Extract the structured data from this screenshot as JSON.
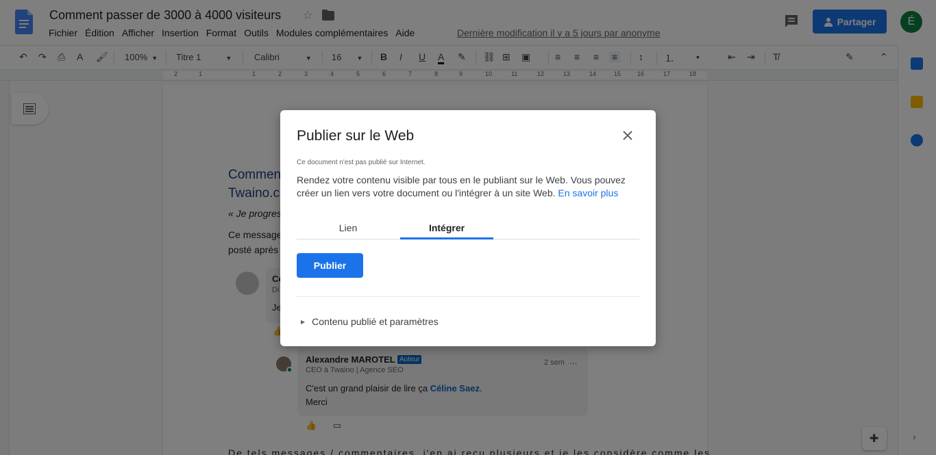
{
  "header": {
    "title": "Comment passer de 3000 à 4000 visiteurs",
    "menu": [
      "Fichier",
      "Édition",
      "Afficher",
      "Insertion",
      "Format",
      "Outils",
      "Modules complémentaires",
      "Aide"
    ],
    "last_edit": "Dernière modification il y a 5 jours par anonyme",
    "share_label": "Partager",
    "avatar_letter": "É"
  },
  "toolbar": {
    "zoom": "100%",
    "style": "Titre 1",
    "font": "Calibri",
    "size": "16"
  },
  "ruler": {
    "numbers": [
      "2",
      "1",
      "1",
      "2",
      "3",
      "4",
      "5",
      "6",
      "7",
      "8",
      "9",
      "10",
      "11",
      "12",
      "13",
      "14",
      "15",
      "16",
      "17",
      "18"
    ]
  },
  "document": {
    "heading_line1": "Comment",
    "heading_line2": "Twaino.c",
    "quote_start": "« Je progres",
    "para_line1": "Ce message",
    "para_line2": "posté après",
    "bottom_line": "De tels messages / commentaires, j'en ai reçu plusieurs et je les considère comme les"
  },
  "comment": {
    "name": "Alexandre MAROTEL",
    "badge": "Auteur",
    "time": "2 sem",
    "subtitle": "CEO à Twaino | Agence SEO",
    "text_before": "C'est un grand plaisir de lire ça ",
    "mention": "Céline Saez",
    "text_line2": "Merci",
    "first_card_initial": "Ce",
    "first_card_sub": "Di",
    "first_card_text": "Je"
  },
  "dialog": {
    "title": "Publier sur le Web",
    "status": "Ce document n'est pas publié sur Internet.",
    "description": "Rendez votre contenu visible par tous en le publiant sur le Web. Vous pouvez créer un lien vers votre document ou l'intégrer à un site Web. ",
    "learn_more": "En savoir plus",
    "tabs": [
      "Lien",
      "Intégrer"
    ],
    "active_tab": "Intégrer",
    "publish_label": "Publier",
    "settings_label": "Contenu publié et paramètres"
  },
  "colors": {
    "accent": "#1a73e8",
    "heading": "#1a3f7a",
    "avatar": "#0b8043"
  }
}
